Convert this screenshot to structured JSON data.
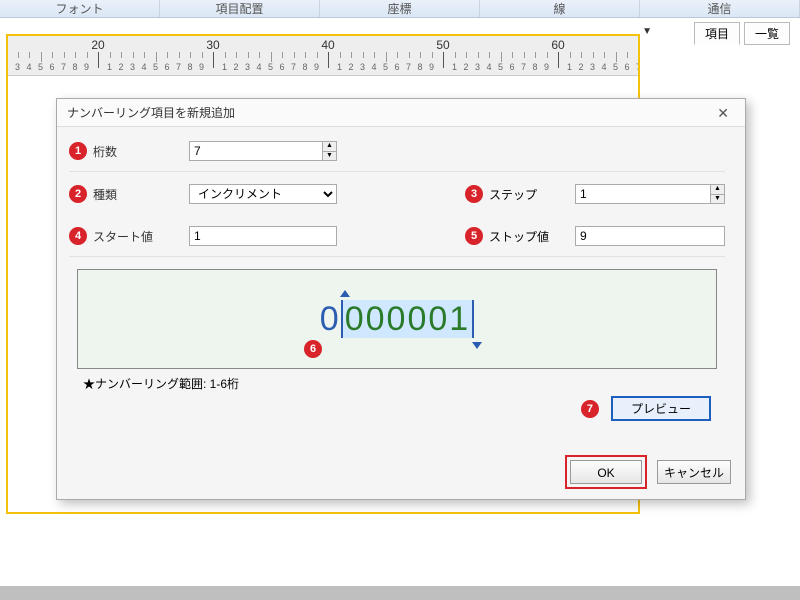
{
  "ribbon": {
    "tabs": [
      "フォント",
      "項目配置",
      "座標",
      "線",
      "通信"
    ]
  },
  "side_tabs": {
    "a": "項目",
    "b": "一覧"
  },
  "ruler": {
    "major": [
      20,
      30,
      40,
      50,
      60
    ],
    "minor_pattern": [
      "5",
      "6",
      "7",
      "8",
      "9",
      "1",
      "2",
      "3",
      "4"
    ]
  },
  "dialog": {
    "title": "ナンバーリング項目を新規追加",
    "fields": {
      "digits_label": "桁数",
      "digits_value": "7",
      "type_label": "種類",
      "type_value": "インクリメント",
      "step_label": "ステップ",
      "step_value": "1",
      "start_label": "スタート値",
      "start_value": "1",
      "stop_label": "ストップ値",
      "stop_value": "9"
    },
    "badges": {
      "b1": "1",
      "b2": "2",
      "b3": "3",
      "b4": "4",
      "b5": "5",
      "b6": "6",
      "b7": "7"
    },
    "preview": {
      "leading": "0",
      "selected": "000001"
    },
    "range_note": "★ナンバーリング範囲: 1-6桁",
    "preview_btn": "プレビュー",
    "ok": "OK",
    "cancel": "キャンセル"
  }
}
